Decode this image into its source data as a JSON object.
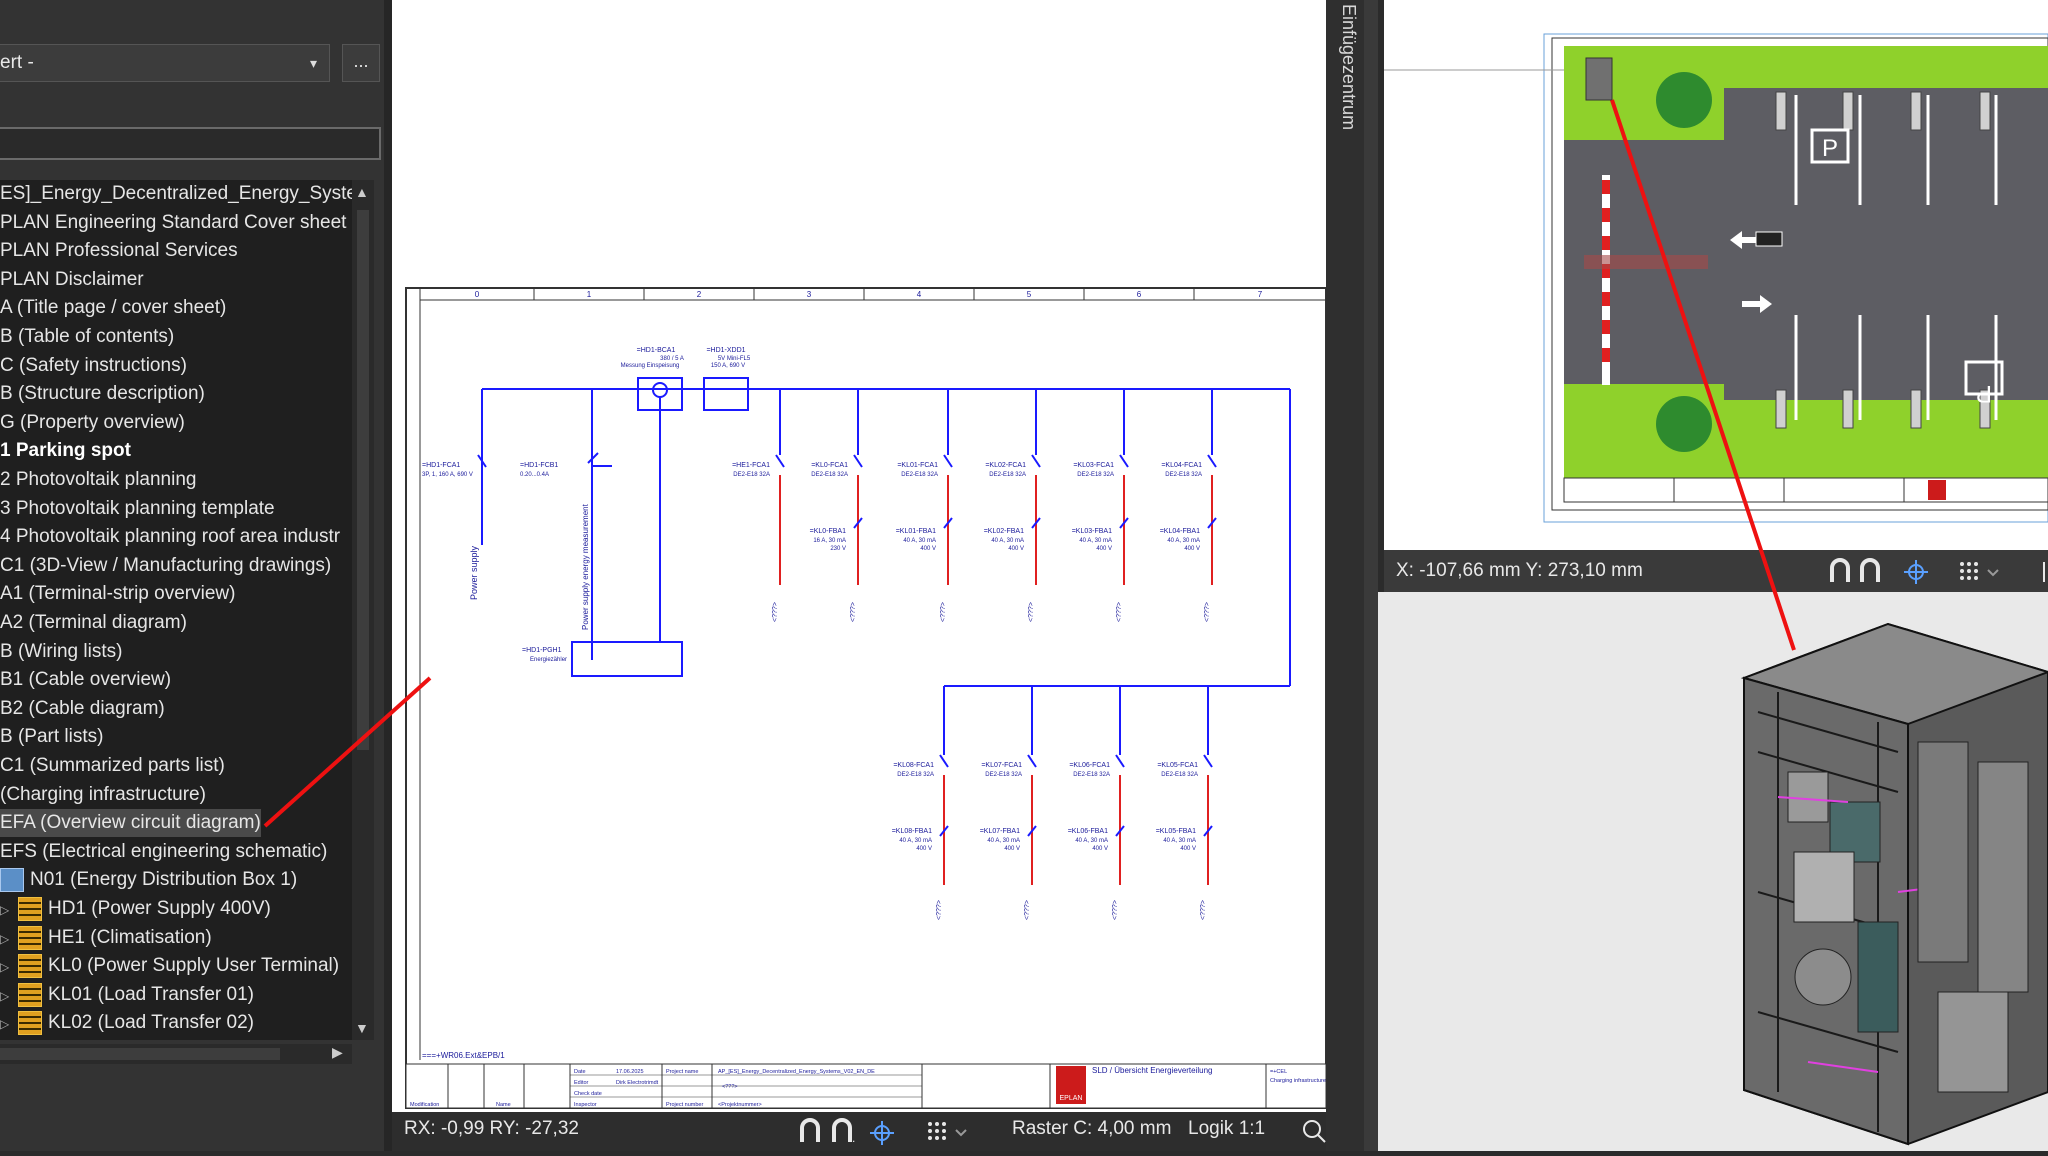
{
  "navigator": {
    "filter_value": "ert -",
    "filter_arrow": "▾",
    "more_label": "...",
    "tree": [
      {
        "label": "ES]_Energy_Decentralized_Energy_System",
        "bold": false,
        "sel": false,
        "icon": "",
        "x": 0
      },
      {
        "label": "PLAN Engineering Standard Cover sheet",
        "bold": false,
        "sel": false,
        "icon": "",
        "x": 0
      },
      {
        "label": "PLAN Professional Services",
        "bold": false,
        "sel": false,
        "icon": "",
        "x": 0
      },
      {
        "label": "PLAN Disclaimer",
        "bold": false,
        "sel": false,
        "icon": "",
        "x": 0
      },
      {
        "label": "A (Title page / cover sheet)",
        "bold": false,
        "sel": false,
        "icon": "",
        "x": 0
      },
      {
        "label": "B (Table of contents)",
        "bold": false,
        "sel": false,
        "icon": "",
        "x": 0
      },
      {
        "label": "C (Safety instructions)",
        "bold": false,
        "sel": false,
        "icon": "",
        "x": 0
      },
      {
        "label": "B (Structure description)",
        "bold": false,
        "sel": false,
        "icon": "",
        "x": 0
      },
      {
        "label": "G (Property overview)",
        "bold": false,
        "sel": false,
        "icon": "",
        "x": 0
      },
      {
        "label": "1 Parking spot",
        "bold": true,
        "sel": false,
        "icon": "",
        "x": 0
      },
      {
        "label": "2 Photovoltaik planning",
        "bold": false,
        "sel": false,
        "icon": "",
        "x": 0
      },
      {
        "label": "3 Photovoltaik planning template",
        "bold": false,
        "sel": false,
        "icon": "",
        "x": 0
      },
      {
        "label": "4 Photovoltaik planning roof area industr",
        "bold": false,
        "sel": false,
        "icon": "",
        "x": 0
      },
      {
        "label": "C1 (3D-View / Manufacturing drawings)",
        "bold": false,
        "sel": false,
        "icon": "",
        "x": 0
      },
      {
        "label": "A1 (Terminal-strip overview)",
        "bold": false,
        "sel": false,
        "icon": "",
        "x": 0
      },
      {
        "label": "A2 (Terminal diagram)",
        "bold": false,
        "sel": false,
        "icon": "",
        "x": 0
      },
      {
        "label": "B (Wiring lists)",
        "bold": false,
        "sel": false,
        "icon": "",
        "x": 0
      },
      {
        "label": "B1 (Cable overview)",
        "bold": false,
        "sel": false,
        "icon": "",
        "x": 0
      },
      {
        "label": "B2 (Cable diagram)",
        "bold": false,
        "sel": false,
        "icon": "",
        "x": 0
      },
      {
        "label": "B (Part lists)",
        "bold": false,
        "sel": false,
        "icon": "",
        "x": 0
      },
      {
        "label": "C1 (Summarized parts list)",
        "bold": false,
        "sel": false,
        "icon": "",
        "x": 0
      },
      {
        "label": "(Charging infrastructure)",
        "bold": false,
        "sel": false,
        "icon": "",
        "x": 0
      },
      {
        "label": "EFA (Overview circuit diagram)",
        "bold": false,
        "sel": true,
        "icon": "",
        "x": 0
      },
      {
        "label": "EFS (Electrical engineering schematic)",
        "bold": false,
        "sel": false,
        "icon": "",
        "x": 0
      },
      {
        "label": "N01 (Energy Distribution Box 1)",
        "bold": false,
        "sel": false,
        "icon": "box",
        "x": 0
      },
      {
        "label": "HD1 (Power Supply 400V)",
        "bold": false,
        "sel": false,
        "icon": "rack",
        "x": 1
      },
      {
        "label": "HE1 (Climatisation)",
        "bold": false,
        "sel": false,
        "icon": "rack",
        "x": 1
      },
      {
        "label": "KL0 (Power Supply User Terminal)",
        "bold": false,
        "sel": false,
        "icon": "rack",
        "x": 1
      },
      {
        "label": "KL01 (Load Transfer 01)",
        "bold": false,
        "sel": false,
        "icon": "rack",
        "x": 1
      },
      {
        "label": "KL02 (Load Transfer 02)",
        "bold": false,
        "sel": false,
        "icon": "rack",
        "x": 1
      }
    ]
  },
  "schematic": {
    "columns": [
      "0",
      "1",
      "2",
      "3",
      "4",
      "5",
      "6",
      "7"
    ],
    "top_devices": [
      {
        "tag": "=HD1-BCA1",
        "sub1": "380 / 5 A",
        "sub2": "Messung Einspeisung"
      },
      {
        "tag": "=HD1-XDD1",
        "sub1": "5V Mini-FL5",
        "sub2": "150 A, 690 V"
      }
    ],
    "main_breaker": {
      "tag": "=HD1-FCA1",
      "spec": "3P, 1, 160 A, 690 V"
    },
    "meter_breaker": {
      "tag": "=HD1-FCB1",
      "spec": "0.20...0.4A"
    },
    "power_supply_label": "Power supply",
    "measurement_label": "Power supply energy measurement",
    "energy_meter": {
      "tag": "=HD1-PGH1",
      "spec": "Energiezähler"
    },
    "row1_breakers": [
      {
        "tag": "=HE1-FCA1",
        "spec": "DE2-E18 32A"
      },
      {
        "tag": "=KL0-FCA1",
        "spec": "DE2-E18 32A"
      },
      {
        "tag": "=KL01-FCA1",
        "spec": "DE2-E18 32A"
      },
      {
        "tag": "=KL02-FCA1",
        "spec": "DE2-E18 32A"
      },
      {
        "tag": "=KL03-FCA1",
        "spec": "DE2-E18 32A"
      },
      {
        "tag": "=KL04-FCA1",
        "spec": "DE2-E18 32A"
      }
    ],
    "row1_rcds": [
      {
        "tag": "=KL0-FBA1",
        "spec1": "16 A, 30 mA",
        "spec2": "230 V"
      },
      {
        "tag": "=KL01-FBA1",
        "spec1": "40 A, 30 mA",
        "spec2": "400 V"
      },
      {
        "tag": "=KL02-FBA1",
        "spec1": "40 A, 30 mA",
        "spec2": "400 V"
      },
      {
        "tag": "=KL03-FBA1",
        "spec1": "40 A, 30 mA",
        "spec2": "400 V"
      },
      {
        "tag": "=KL04-FBA1",
        "spec1": "40 A, 30 mA",
        "spec2": "400 V"
      }
    ],
    "row2_breakers": [
      {
        "tag": "=KL08-FCA1",
        "spec": "DE2-E18 32A"
      },
      {
        "tag": "=KL07-FCA1",
        "spec": "DE2-E18 32A"
      },
      {
        "tag": "=KL06-FCA1",
        "spec": "DE2-E18 32A"
      },
      {
        "tag": "=KL05-FCA1",
        "spec": "DE2-E18 32A"
      }
    ],
    "row2_rcds": [
      {
        "tag": "=KL08-FBA1",
        "spec1": "40 A, 30 mA",
        "spec2": "400 V"
      },
      {
        "tag": "=KL07-FBA1",
        "spec1": "40 A, 30 mA",
        "spec2": "400 V"
      },
      {
        "tag": "=KL06-FBA1",
        "spec1": "40 A, 30 mA",
        "spec2": "400 V"
      },
      {
        "tag": "=KL05-FBA1",
        "spec1": "40 A, 30 mA",
        "spec2": "400 V"
      }
    ],
    "cross_ref": "<???>",
    "page_ref": "===+WR06.Ext&EPB/1",
    "title_block": {
      "date_label": "Date",
      "date_value": "17.06.2025",
      "editor_label": "Editor",
      "editor_value": "Dirk Electrotrimdt",
      "check_label": "Check date",
      "inspector_label": "Inspector",
      "modification_label": "Modification",
      "name_label": "Name",
      "project_name_label": "Project name",
      "project_name_value": "AP_[ES]_Energy_Decentralized_Energy_Systems_V02_EN_DE",
      "project_number_label": "Project number",
      "project_number_value": "<Projektnummer>",
      "placeholder": "<???>",
      "logo_text": "EPLAN",
      "sheet_title": "SLD / Übersicht Energieverteilung",
      "right_ref": "=+CEL",
      "right_sub": "Charging infrastructure"
    }
  },
  "status_bar": {
    "rel_coords": "RX: -0,99 RY: -27,32",
    "raster": "Raster C: 4,00 mm",
    "logik": "Logik 1:1"
  },
  "side_tab": {
    "label": "Einfügezentrum"
  },
  "layout_view": {
    "coords": "X: -107,66 mm Y: 273,10 mm",
    "parking_sign": "P",
    "accent_green": "#8fd12b",
    "asphalt": "#5d5d63"
  },
  "colors": {
    "wire_blue": "#1a1aff",
    "wire_red": "#e02020",
    "annotation_red": "#ee1111"
  }
}
